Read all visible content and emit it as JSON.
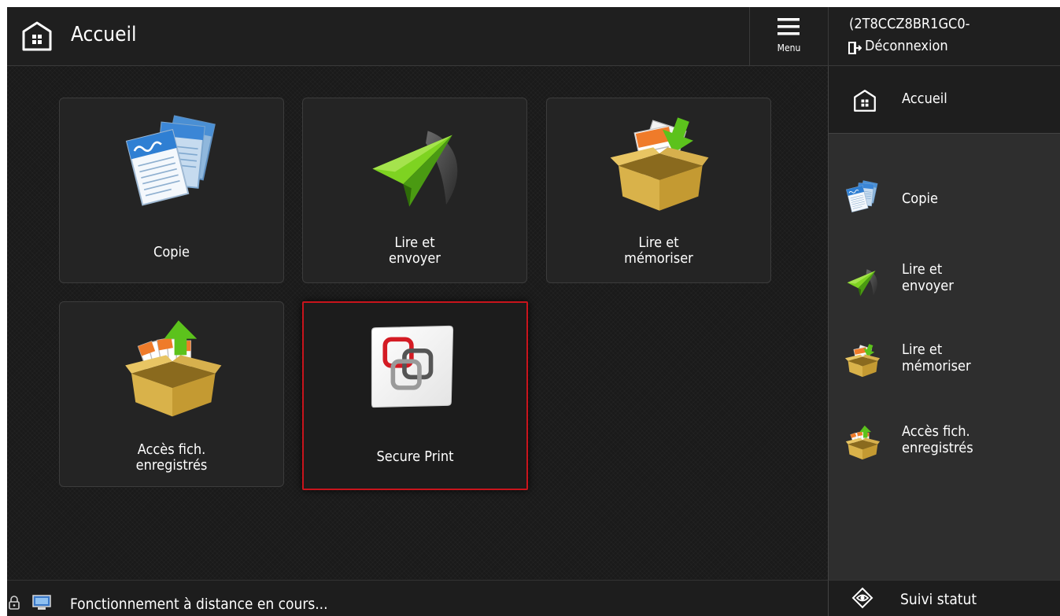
{
  "header": {
    "title": "Accueil",
    "menu_label": "Menu"
  },
  "user": {
    "name": "(2T8CCZ8BR1GC0-",
    "logout_label": "Déconnexion"
  },
  "tiles": [
    {
      "line1": "Copie",
      "line2": "",
      "icon": "copy-icon"
    },
    {
      "line1": "Lire et",
      "line2": "envoyer",
      "icon": "paper-plane-icon"
    },
    {
      "line1": "Lire et",
      "line2": "mémoriser",
      "icon": "store-box-icon"
    },
    {
      "line1": "Accès fich.",
      "line2": "enregistrés",
      "icon": "stored-files-box-icon"
    },
    {
      "line1": "Secure Print",
      "line2": "",
      "icon": "secure-print-icon",
      "selected": true
    }
  ],
  "sidebar": {
    "home_label": "Accueil",
    "items": [
      {
        "line1": "Copie",
        "line2": "",
        "icon": "copy-icon"
      },
      {
        "line1": "Lire et",
        "line2": "envoyer",
        "icon": "paper-plane-icon"
      },
      {
        "line1": "Lire et",
        "line2": "mémoriser",
        "icon": "store-box-icon"
      },
      {
        "line1": "Accès fich.",
        "line2": "enregistrés",
        "icon": "stored-files-box-icon"
      }
    ]
  },
  "statusbar": {
    "text": "Fonctionnement à distance en cours..."
  },
  "status_button": {
    "label": "Suivi statut"
  },
  "colors": {
    "selection_border": "#c9141c",
    "background": "#161616",
    "panel": "#2e2e2e"
  }
}
